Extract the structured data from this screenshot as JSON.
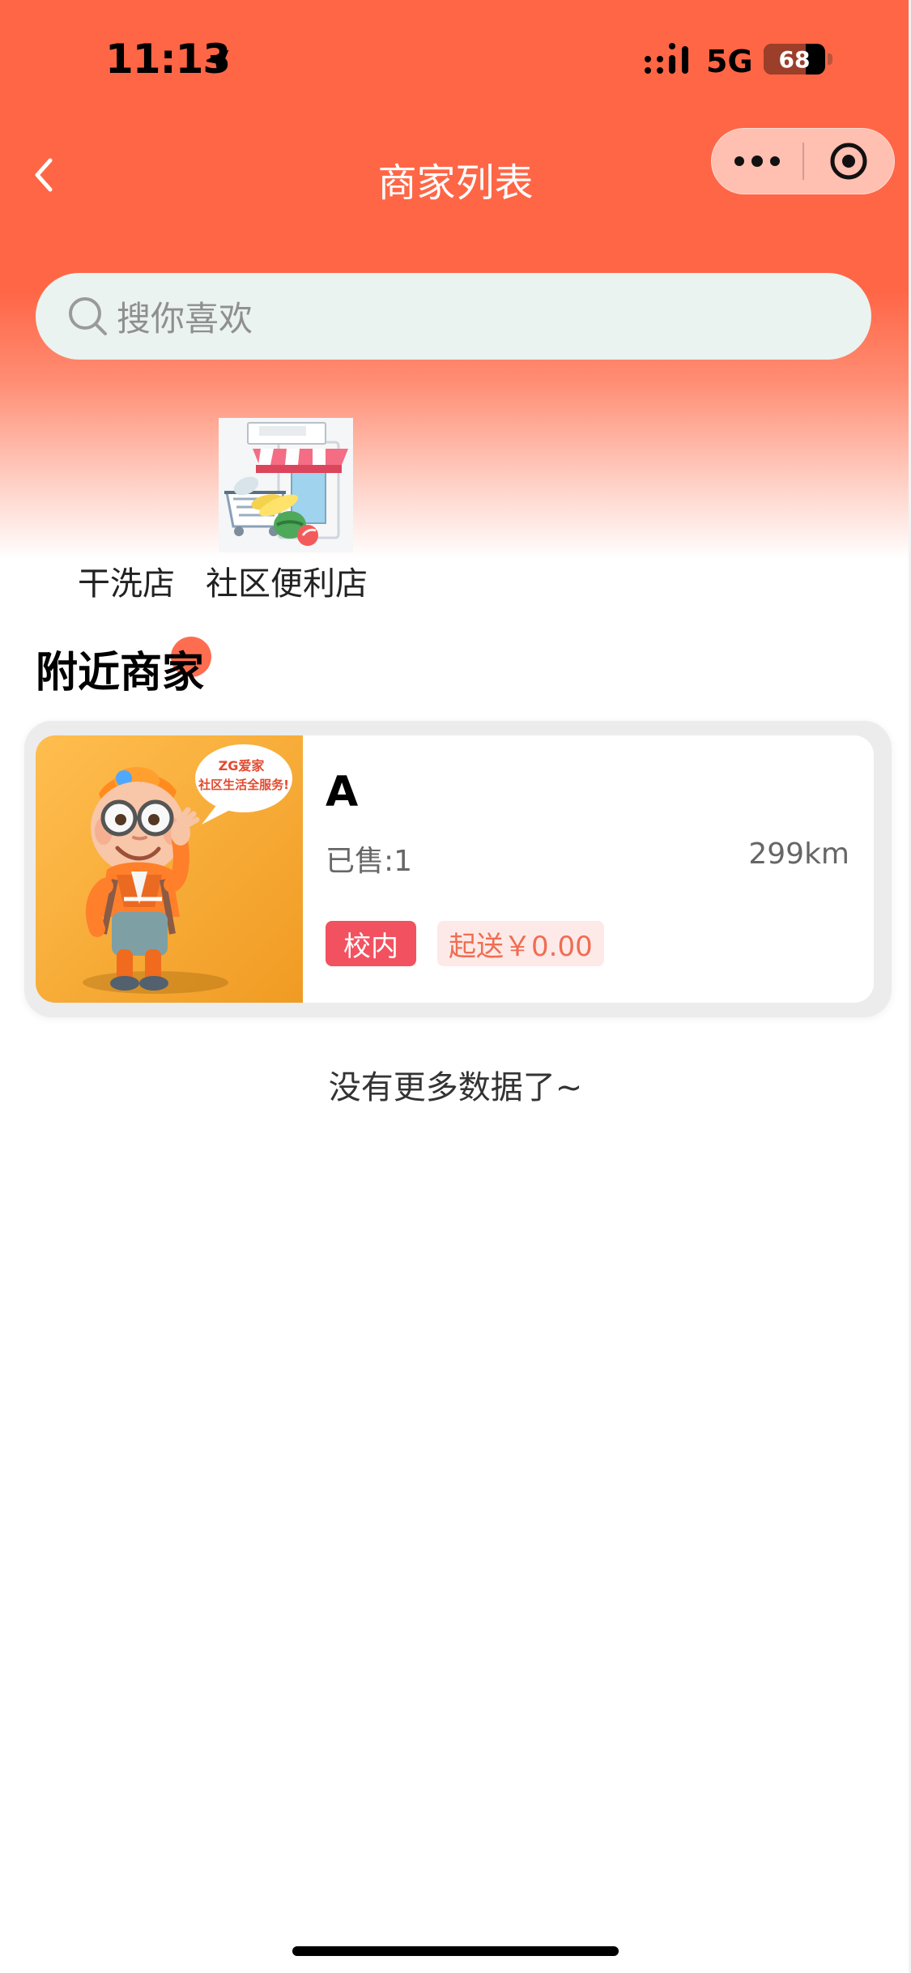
{
  "status_bar": {
    "time": "11:13",
    "network": "5G",
    "battery": "68",
    "battery_level": 68
  },
  "navbar": {
    "title": "商家列表"
  },
  "search": {
    "placeholder": "搜你喜欢"
  },
  "categories": [
    {
      "label": "干洗店"
    },
    {
      "label": "社区便利店"
    }
  ],
  "section": {
    "title": "附近商家"
  },
  "merchants": [
    {
      "name": "A",
      "sold": "已售:1",
      "distance": "299km",
      "tag_campus": "校内",
      "tag_delivery": "起送￥0.00",
      "bubble_line1": "ZG爱家",
      "bubble_line2": "社区生活全服务!"
    }
  ],
  "footer": {
    "no_more": "没有更多数据了~"
  },
  "colors": {
    "header": "#ff6646",
    "search_bg": "#eaf3ef",
    "campus_tag": "#f25260",
    "delivery_tag_bg": "#fde9e7",
    "delivery_tag_text": "#ef6d52"
  },
  "icons": {
    "back": "chevron-left-icon",
    "more": "more-dots-icon",
    "close": "target-close-icon",
    "search": "search-icon",
    "location": "location-arrow-icon"
  }
}
